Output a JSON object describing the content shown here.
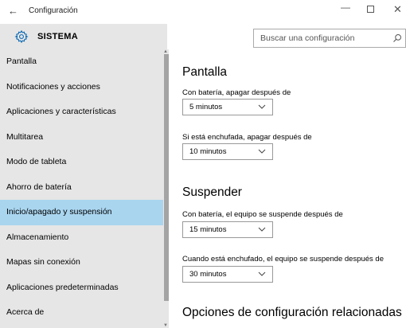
{
  "window": {
    "title": "Configuración",
    "back_glyph": "←",
    "minimize_glyph": "—",
    "close_glyph": "✕"
  },
  "header": {
    "section": "SISTEMA"
  },
  "search": {
    "placeholder": "Buscar una configuración"
  },
  "sidebar": {
    "items": [
      {
        "label": "Pantalla",
        "selected": false
      },
      {
        "label": "Notificaciones y acciones",
        "selected": false
      },
      {
        "label": "Aplicaciones y características",
        "selected": false
      },
      {
        "label": "Multitarea",
        "selected": false
      },
      {
        "label": "Modo de tableta",
        "selected": false
      },
      {
        "label": "Ahorro de batería",
        "selected": false
      },
      {
        "label": "Inicio/apagado y suspensión",
        "selected": true
      },
      {
        "label": "Almacenamiento",
        "selected": false
      },
      {
        "label": "Mapas sin conexión",
        "selected": false
      },
      {
        "label": "Aplicaciones predeterminadas",
        "selected": false
      },
      {
        "label": "Acerca de",
        "selected": false
      }
    ]
  },
  "main": {
    "screen": {
      "title": "Pantalla",
      "battery_label": "Con batería, apagar después de",
      "battery_value": "5 minutos",
      "plugged_label": "Si está enchufada, apagar después de",
      "plugged_value": "10 minutos"
    },
    "sleep": {
      "title": "Suspender",
      "battery_label": "Con batería, el equipo se suspende después de",
      "battery_value": "15 minutos",
      "plugged_label": "Cuando está enchufado, el equipo se suspende después de",
      "plugged_value": "30 minutos"
    },
    "related": {
      "title": "Opciones de configuración relacionadas"
    }
  },
  "colors": {
    "sidebar_bg": "#e6e6e6",
    "selected_bg": "#a9d5ef",
    "accent": "#0063b1"
  }
}
